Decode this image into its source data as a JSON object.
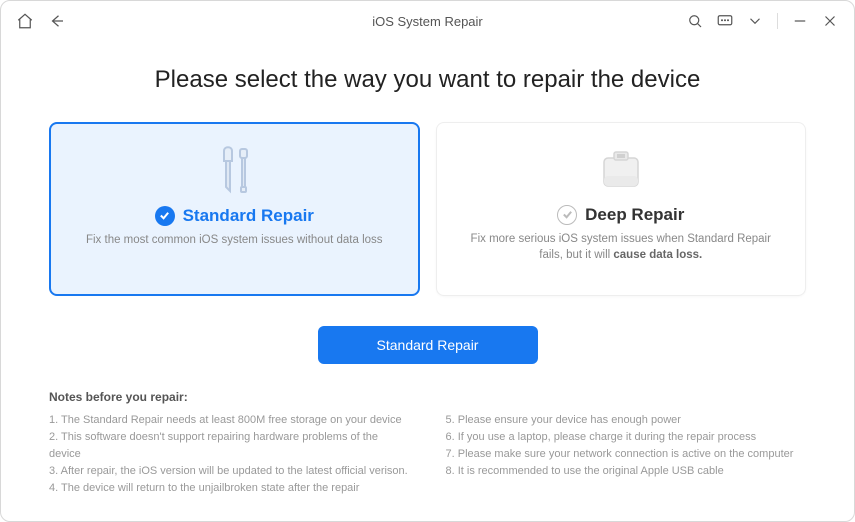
{
  "titlebar": {
    "title": "iOS System Repair"
  },
  "heading": "Please select the way you want to repair the device",
  "cards": {
    "standard": {
      "title": "Standard Repair",
      "desc": "Fix the most common iOS system issues without data loss"
    },
    "deep": {
      "title": "Deep Repair",
      "desc_prefix": "Fix more serious iOS system issues when Standard Repair fails, but it will ",
      "desc_bold": "cause data loss."
    }
  },
  "primary_button": "Standard Repair",
  "notes": {
    "title": "Notes before you repair:",
    "left": [
      "1.  The Standard Repair needs at least 800M free storage on your device",
      "2.  This software doesn't support repairing hardware problems of the device",
      "3.  After repair, the iOS version will be updated to the latest official verison.",
      "4.  The device will return to the unjailbroken state after the repair"
    ],
    "right": [
      "5.  Please ensure your device has enough power",
      "6.  If you use a laptop, please charge it during the repair process",
      "7.  Please make sure your network connection is active on the computer",
      "8.  It is recommended to use the original Apple USB cable"
    ]
  }
}
